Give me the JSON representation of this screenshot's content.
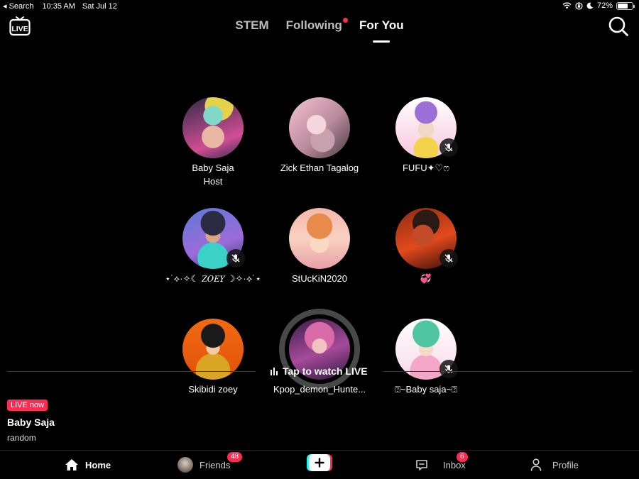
{
  "status_bar": {
    "back_app": "◂ Search",
    "time": "10:35 AM",
    "date": "Sat Jul 12",
    "battery_text": "72%",
    "battery_level": 0.72
  },
  "top_nav": {
    "tabs": [
      {
        "label": "STEM",
        "active": false
      },
      {
        "label": "Following",
        "active": false,
        "has_dot": true
      },
      {
        "label": "For You",
        "active": true
      }
    ]
  },
  "hosts": [
    {
      "name": "Baby Saja",
      "role": "Host",
      "muted": false
    },
    {
      "name": "Zick Ethan Tagalog",
      "muted": false
    },
    {
      "name": "FUFU✦♡ෆ",
      "muted": true
    },
    {
      "name": "⋆˙⟡·✧☾ 𝑍𝑂𝐸𝑌 ☽✧·⟡˙⋆",
      "muted": true
    },
    {
      "name": "StUcKiN2020",
      "muted": false
    },
    {
      "name": "💞",
      "muted": true
    },
    {
      "name": "Skibidi zoey",
      "muted": false
    },
    {
      "name": "Kpop_demon_Hunte...",
      "muted": false
    },
    {
      "name": "⍰~Baby saja~⍰",
      "muted": true
    }
  ],
  "center_action": {
    "label": "Tap to watch LIVE"
  },
  "live_info": {
    "badge": "LIVE now",
    "host_name": "Baby Saja",
    "subtitle": "random"
  },
  "bottom_nav": {
    "home": "Home",
    "friends": "Friends",
    "friends_count": "48",
    "inbox": "Inbox",
    "inbox_count": "6",
    "profile": "Profile"
  },
  "colors": {
    "accent": "#fe2c55",
    "background": "#000000",
    "create_cyan": "#25f4ee",
    "create_red": "#fe2c55"
  }
}
